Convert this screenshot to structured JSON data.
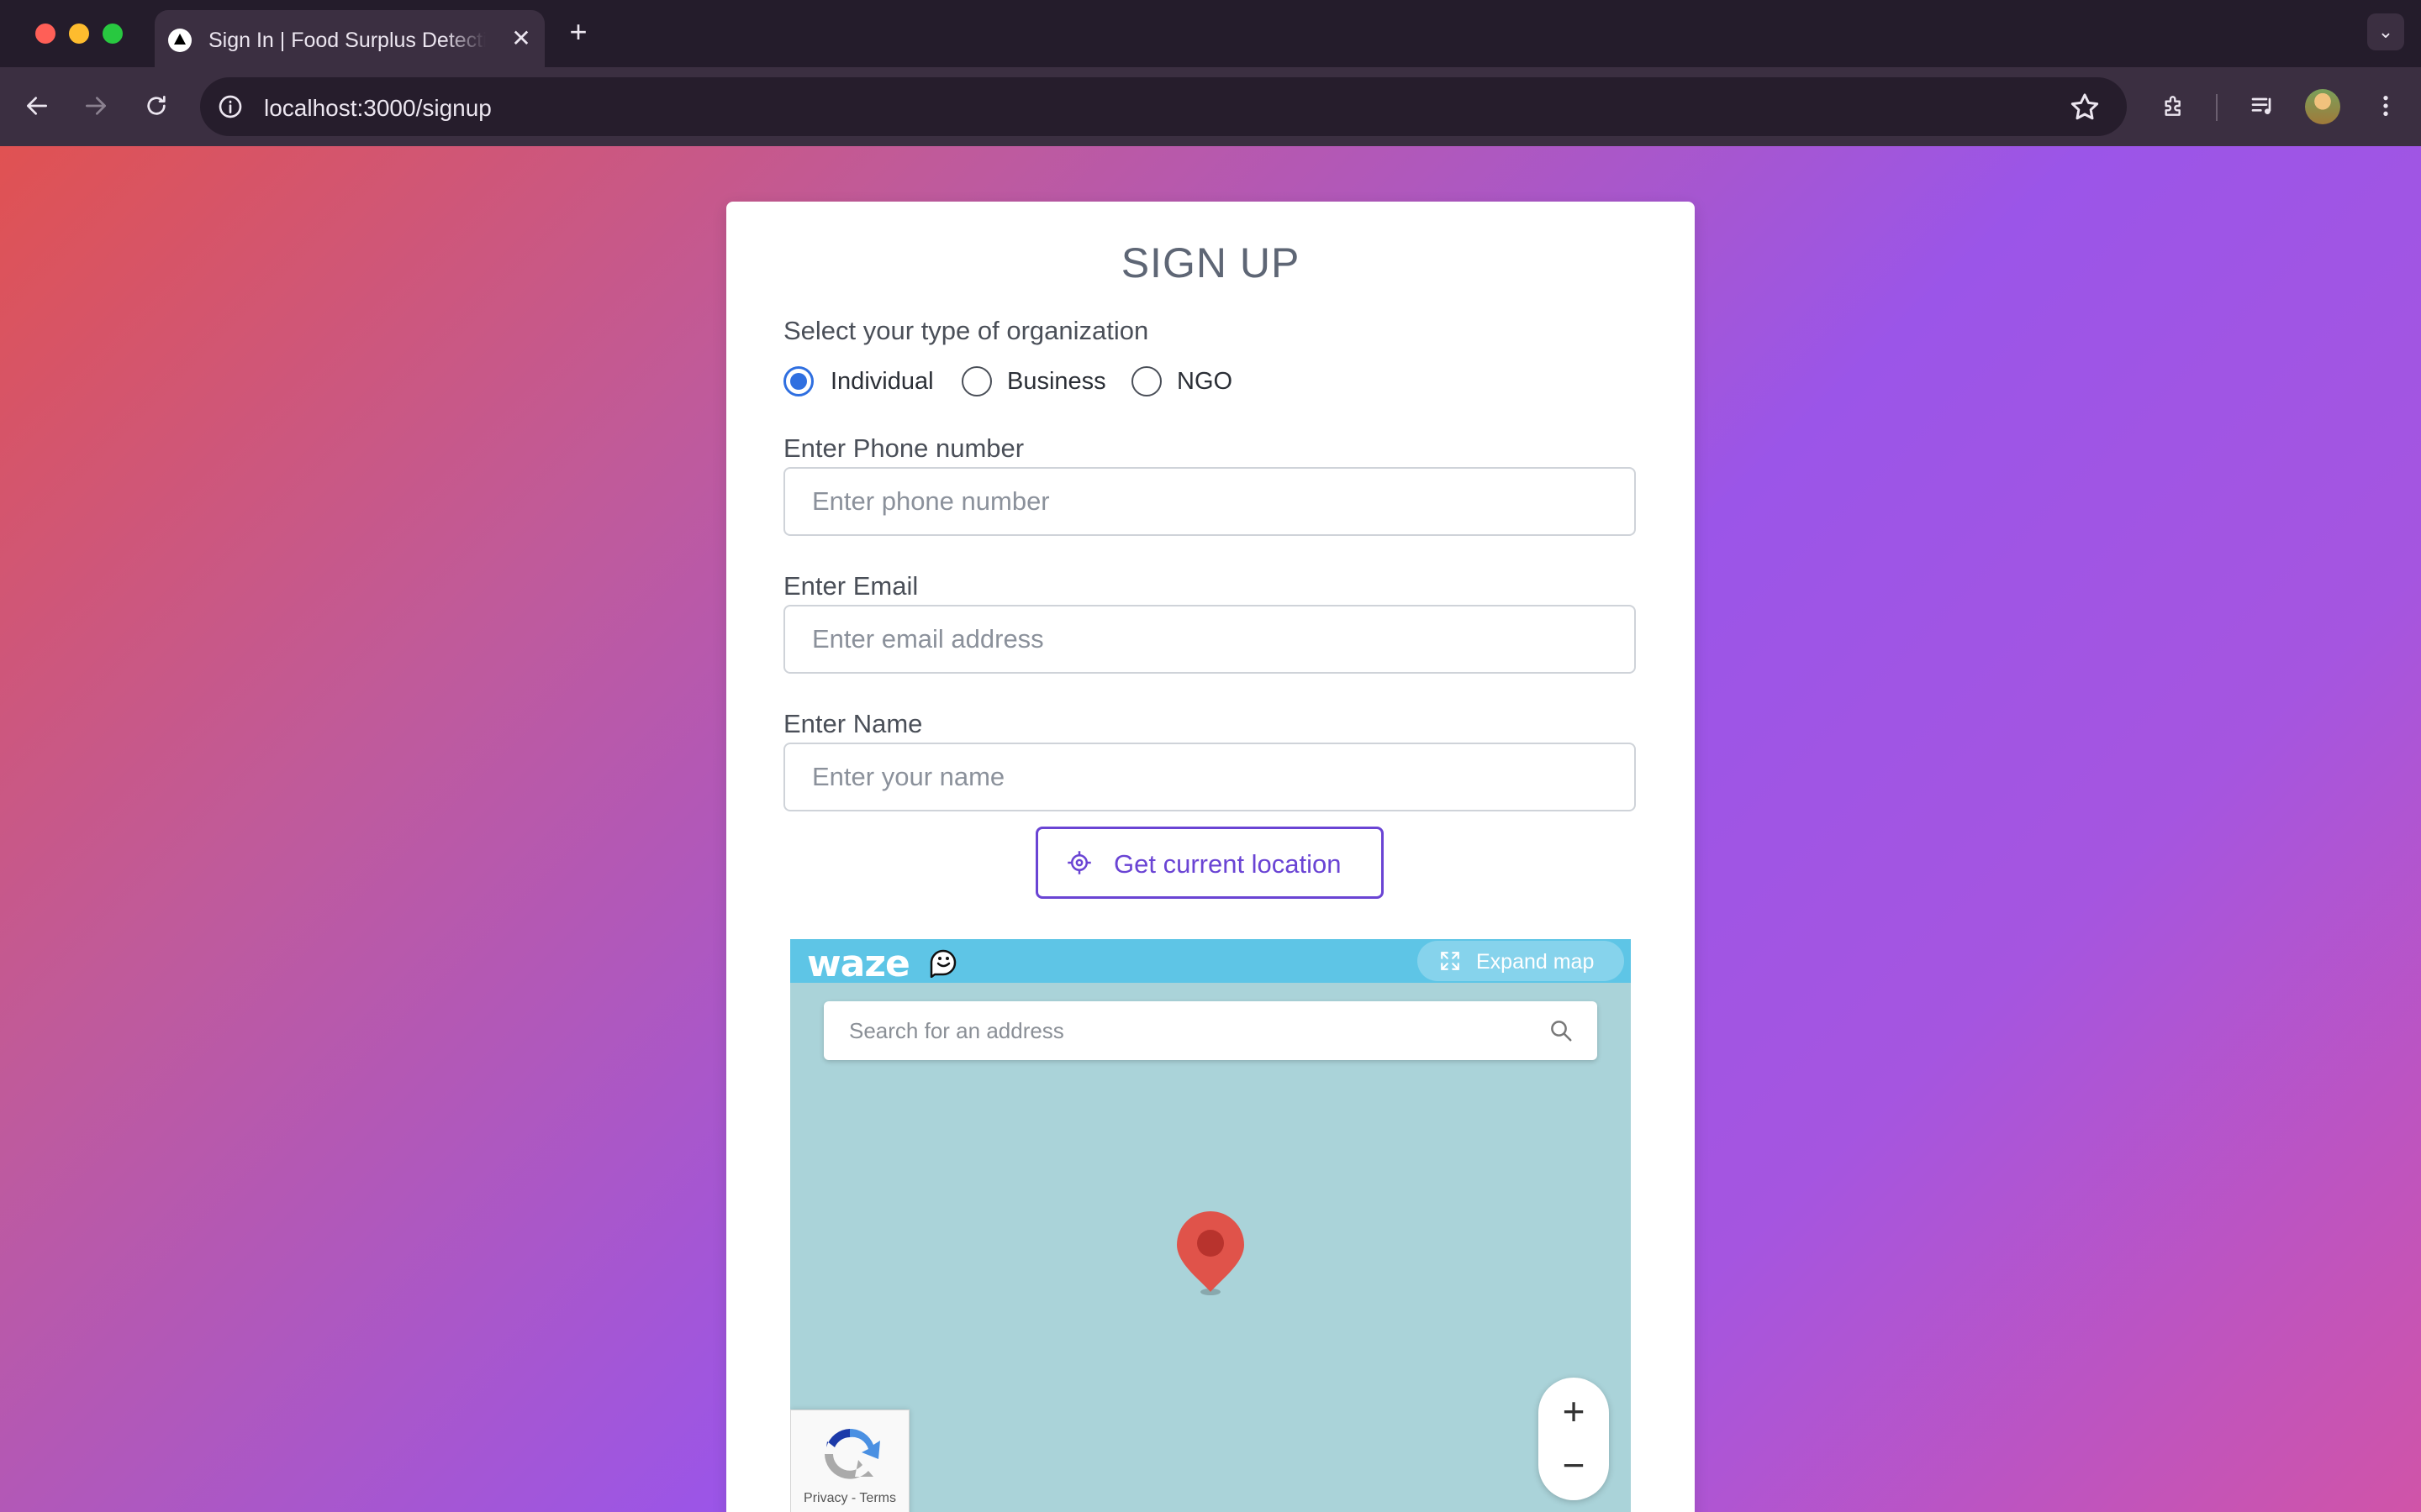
{
  "browser": {
    "tab_title": "Sign In | Food Surplus Detection",
    "tab_close": "✕",
    "new_tab": "+",
    "tab_menu": "⌄",
    "url": "localhost:3000/signup"
  },
  "form": {
    "title": "SIGN UP",
    "org_type_label": "Select your type of organization",
    "org_types": [
      {
        "label": "Individual",
        "checked": true
      },
      {
        "label": "Business",
        "checked": false
      },
      {
        "label": "NGO",
        "checked": false
      }
    ],
    "phone": {
      "label": "Enter Phone number",
      "placeholder": "Enter phone number",
      "value": ""
    },
    "email": {
      "label": "Enter Email",
      "placeholder": "Enter email address",
      "value": ""
    },
    "name": {
      "label": "Enter Name",
      "placeholder": "Enter your name",
      "value": ""
    },
    "location_button": "Get current location"
  },
  "map": {
    "brand": "waze",
    "expand_label": "Expand map",
    "search_placeholder": "Search for an address",
    "zoom_in": "+",
    "zoom_out": "−",
    "recaptcha_links": "Privacy - Terms"
  },
  "colors": {
    "accent": "#6a44d4",
    "radio_checked": "#2f6fe0",
    "map_water": "#aad3d9",
    "waze_header": "#5ec5e6",
    "pin": "#e0534a"
  }
}
